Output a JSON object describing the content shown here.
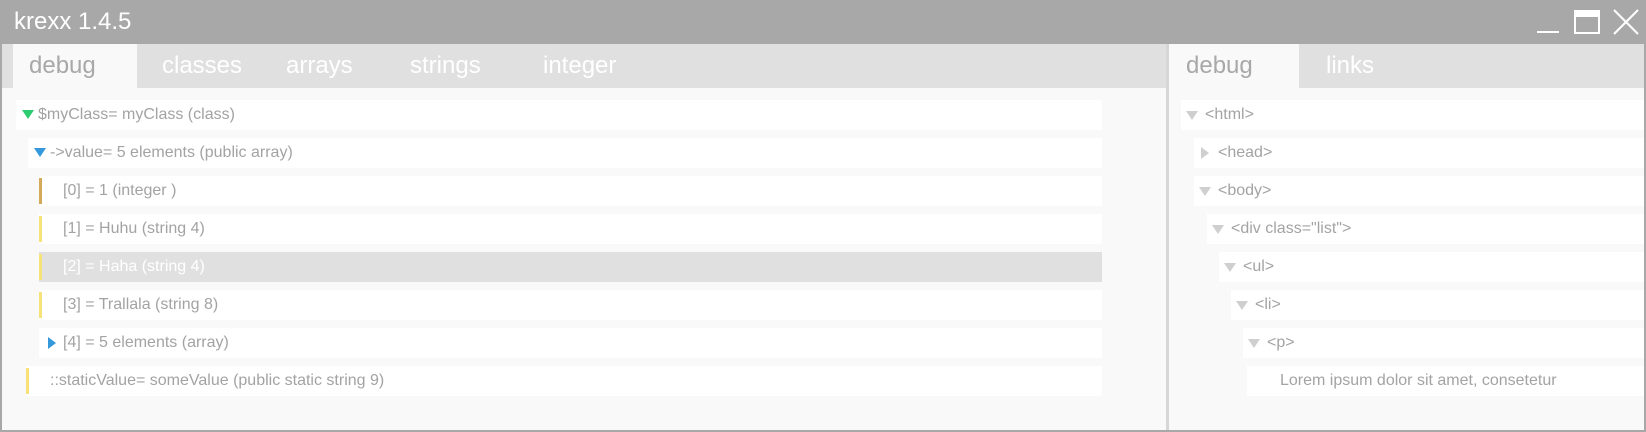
{
  "window": {
    "title": "krexx 1.4.5"
  },
  "left_tabs": [
    "debug",
    "classes",
    "arrays",
    "strings",
    "integer"
  ],
  "right_tabs": [
    "debug",
    "links"
  ],
  "debug_tree": [
    {
      "text": "$myClass= myClass (class)",
      "toggle": "expanded",
      "accent": "#2ecc71"
    },
    {
      "text": "->value= 5 elements (public array)",
      "toggle": "expanded",
      "accent": "#3498db"
    },
    {
      "text": "[0] = 1 (integer )",
      "bar_color": "#d4a95a"
    },
    {
      "text": "[1] = Huhu (string 4)",
      "bar_color": "#f7e27a"
    },
    {
      "text": "[2] = Haha (string 4)",
      "bar_color": "#f7e27a",
      "selected": true
    },
    {
      "text": "[3] = Trallala (string 8)",
      "bar_color": "#f7e27a"
    },
    {
      "text": "[4] = 5 elements (array)",
      "toggle": "collapsed",
      "accent": "#3498db"
    },
    {
      "text": "::staticValue= someValue (public static string 9)",
      "bar_color": "#f7e27a"
    }
  ],
  "dom_tree": [
    {
      "text": "<html>",
      "toggle": "expanded"
    },
    {
      "text": "<head>",
      "toggle": "collapsed"
    },
    {
      "text": "<body>",
      "toggle": "expanded"
    },
    {
      "text": "<div class=\"list\">",
      "toggle": "expanded"
    },
    {
      "text": "<ul>",
      "toggle": "expanded"
    },
    {
      "text": "<li>",
      "toggle": "expanded"
    },
    {
      "text": "<p>",
      "toggle": "expanded"
    },
    {
      "text": "Lorem ipsum dolor sit amet, consetetur"
    }
  ],
  "colors": {
    "titlebar": "#a8a8a8",
    "tabbar": "#e0e0e0",
    "text": "#a3a3a3",
    "toggle_gray": "#cfcfcf"
  }
}
